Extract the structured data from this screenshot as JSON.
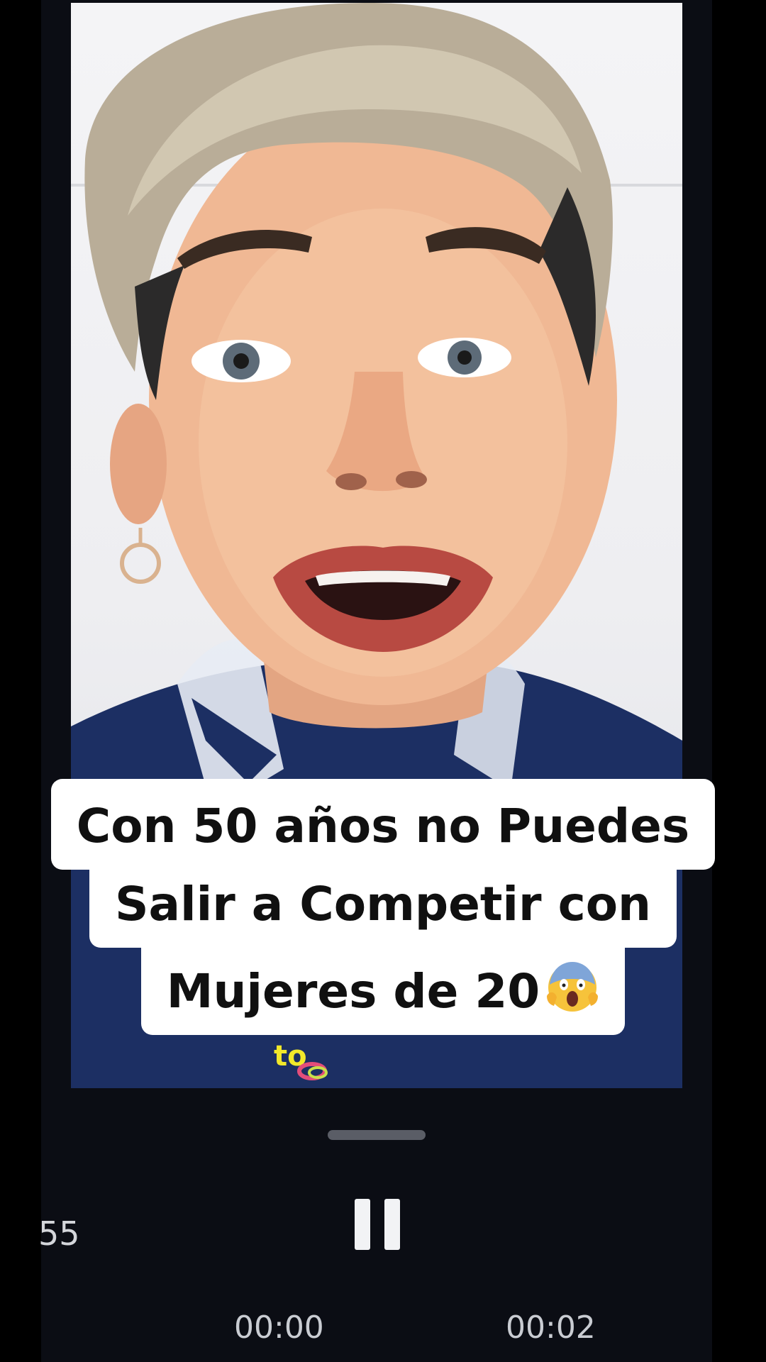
{
  "caption": {
    "line1": "Con 50 años no Puedes",
    "line2": "Salir a Competir con",
    "line3": "Mujeres de 20"
  },
  "caption_emoji": "face-screaming-in-fear-emoji",
  "watermark_text": "to",
  "player": {
    "side_time": "55",
    "current_time": "00:00",
    "total_time": "00:02",
    "state_icon": "pause-icon"
  },
  "colors": {
    "background": "#000000",
    "panel": "#0b0d14",
    "caption_bg": "#ffffff",
    "caption_text": "#101010",
    "time_text": "#c9ccd2"
  }
}
